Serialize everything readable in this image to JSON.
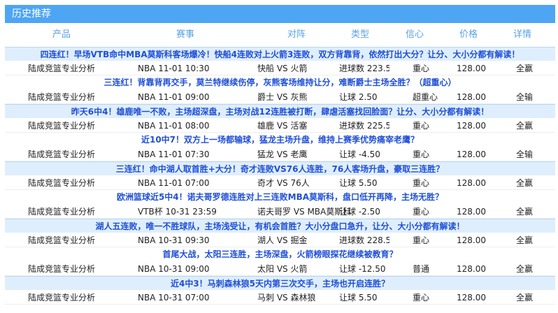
{
  "header": {
    "title": "历史推荐"
  },
  "columns": {
    "product": "产品",
    "event": "赛事",
    "match": "对阵",
    "type": "类型",
    "confidence": "信心",
    "price": "价格",
    "detail": "详情"
  },
  "records": [
    {
      "title": "四连红！早场VTB命中MBA莫斯科客场爆冷！快船4连败对上火箭3连败，双方背靠背，依然打出大分？让分、大小分都有解读！",
      "product": "陆成竞篮专业分析",
      "event": "NBA 11-01 10:30",
      "match": "快船 VS 火箭",
      "type": "进球数 223.50",
      "confidence": "重心",
      "price": "128.00",
      "detail": "全赢",
      "shaded": true
    },
    {
      "title": "三连红！背靠背再交手，莫兰特继续伤停，灰熊客场维持让分，难断爵士主场全胜？（超重心）",
      "product": "陆成竞篮专业分析",
      "event": "NBA 11-01 09:00",
      "match": "爵士 VS 灰熊",
      "type": "让球 2.50",
      "confidence": "超重心",
      "price": "128.00",
      "detail": "全输",
      "shaded": false
    },
    {
      "title": "昨天6中4！雄鹿唯一不败，主场超深盘，主场对战12连胜被打断，肆虐活塞找回脸面？让分、大小分都有解读！",
      "product": "陆成竞篮专业分析",
      "event": "NBA 11-01 08:00",
      "match": "雄鹿 VS 活塞",
      "type": "进球数 225.50",
      "confidence": "重心",
      "price": "128.00",
      "detail": "全赢",
      "shaded": true
    },
    {
      "title": "近10中7！双方上一场都输球，猛龙主场升盘，维持上赛季优势痛宰老鹰？",
      "product": "陆成竞篮专业分析",
      "event": "NBA 11-01 07:30",
      "match": "猛龙 VS 老鹰",
      "type": "让球 -4.50",
      "confidence": "重心",
      "price": "128.00",
      "detail": "全输",
      "shaded": false
    },
    {
      "title": "三连红！命中湖人取首胜+大分！奇才连败VS76人连胜，76人客场升盘，豪取三连胜？",
      "product": "陆成竞篮专业分析",
      "event": "NBA 11-01 07:00",
      "match": "奇才 VS 76人",
      "type": "让球 5.50",
      "confidence": "重心",
      "price": "128.00",
      "detail": "全赢",
      "shaded": true
    },
    {
      "title": "欧洲篮球近5中4！诺夫哥罗德连胜对上三连败MBA莫斯科，盘口低开再降，主场无胜？",
      "product": "陆成竞篮专业分析",
      "event": "VTB杯 10-31 23:59",
      "match": "诺夫哥罗 VS MBA莫斯科",
      "type": "让球 -2.50",
      "confidence": "重心",
      "price": "128.00",
      "detail": "全赢",
      "shaded": false
    },
    {
      "title": "湖人五连败，唯一不胜球队，主场浅受让，有机会首胜？大小分盘口急升，让分、大小分都有解读！",
      "product": "陆成竞篮专业分析",
      "event": "NBA 10-31 09:30",
      "match": "湖人 VS 掘金",
      "type": "进球数 228.50",
      "confidence": "重心",
      "price": "128.00",
      "detail": "全赢",
      "shaded": true
    },
    {
      "title": "首尾大战，太阳三连胜，主场深盘，火箭榜眼探花继续被教育？",
      "product": "陆成竞篮专业分析",
      "event": "NBA 10-31 09:00",
      "match": "太阳 VS 火箭",
      "type": "让球 -12.50",
      "confidence": "普通",
      "price": "128.00",
      "detail": "全赢",
      "shaded": false
    },
    {
      "title": "近4中3！马刺森林狼5天内第三次交手，主场也开启连胜？",
      "product": "陆成竞篮专业分析",
      "event": "NBA 10-31 07:00",
      "match": "马刺 VS 森林狼",
      "type": "让球 5.50",
      "confidence": "重心",
      "price": "128.00",
      "detail": "全赢",
      "shaded": true
    }
  ]
}
